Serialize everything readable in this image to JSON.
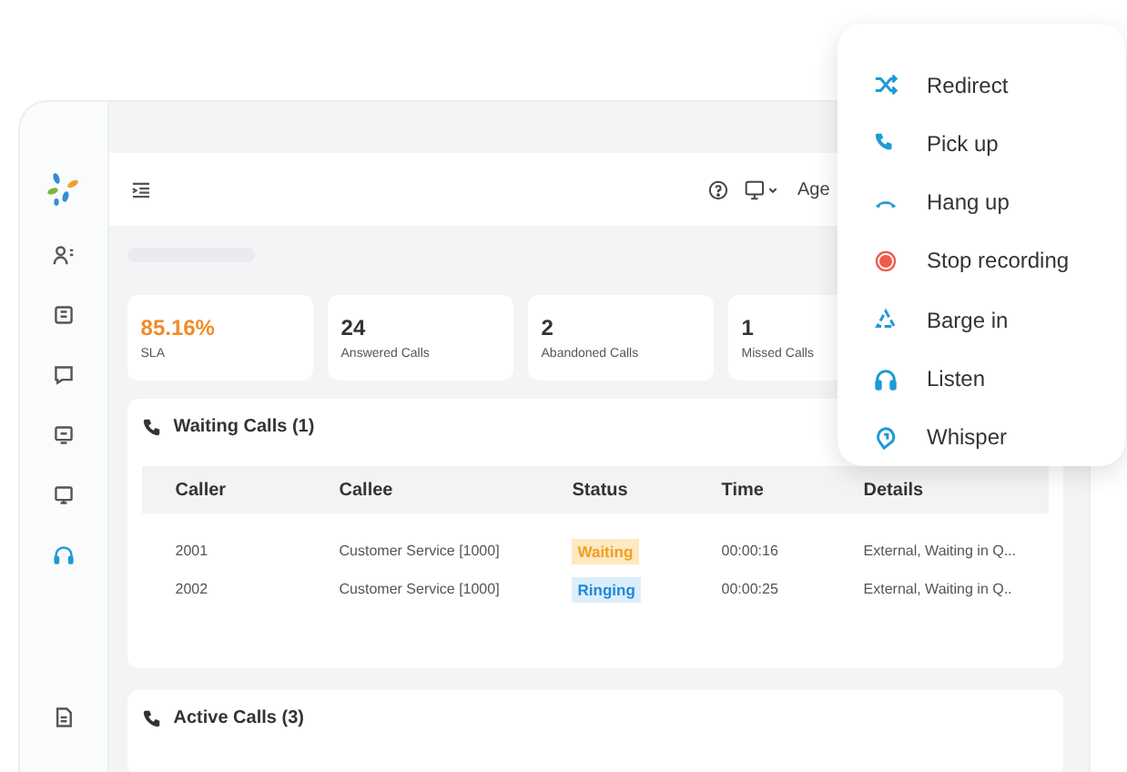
{
  "sidebar": {
    "items": [
      {
        "selected": false
      },
      {
        "selected": false
      },
      {
        "selected": false
      },
      {
        "selected": false
      },
      {
        "selected": false
      },
      {
        "selected": true
      }
    ]
  },
  "header": {
    "agent_label": "Age"
  },
  "stats": [
    {
      "value": "85.16%",
      "label": "SLA",
      "kind": "highlight"
    },
    {
      "value": "24",
      "label": "Answered Calls",
      "kind": "plain"
    },
    {
      "value": "2",
      "label": "Abandoned Calls",
      "kind": "plain"
    },
    {
      "value": "1",
      "label": "Missed Calls",
      "kind": "plain"
    }
  ],
  "waiting_calls": {
    "title": "Waiting Calls (1)",
    "columns": [
      "Caller",
      "Callee",
      "Status",
      "Time",
      "Details"
    ],
    "rows": [
      {
        "caller": "2001",
        "callee": "Customer Service [1000]",
        "status": "Waiting",
        "kind": "waiting",
        "time": "00:00:16",
        "details": "External, Waiting in Q..."
      },
      {
        "caller": "2002",
        "callee": "Customer Service [1000]",
        "status": "Ringing",
        "kind": "ringing",
        "time": "00:00:25",
        "details": "External, Waiting in Q.."
      }
    ]
  },
  "active_calls": {
    "title": "Active Calls (3)"
  },
  "context_menu": [
    {
      "label": "Redirect"
    },
    {
      "label": "Pick up"
    },
    {
      "label": "Hang up"
    },
    {
      "label": "Stop recording"
    },
    {
      "label": "Barge in"
    },
    {
      "label": "Listen"
    },
    {
      "label": "Whisper"
    }
  ]
}
